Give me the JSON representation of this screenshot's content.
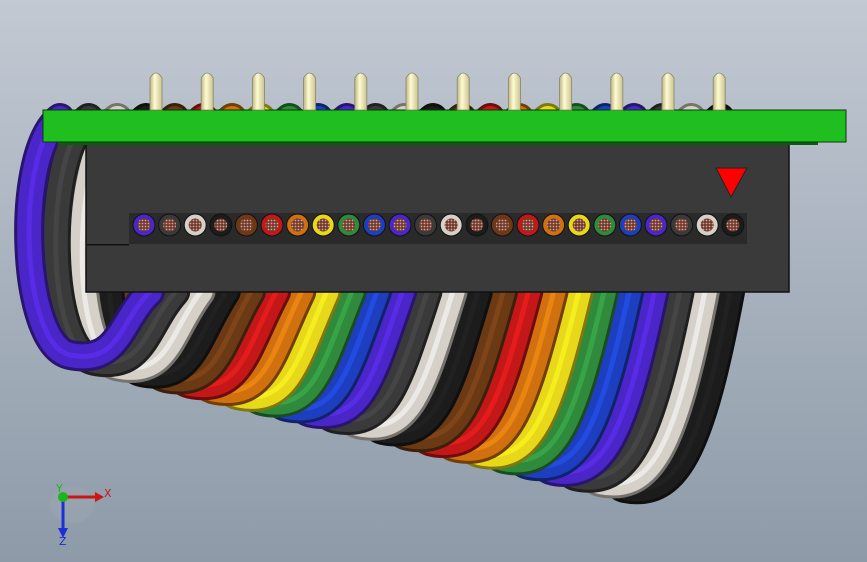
{
  "viewport": {
    "background_top": "#c2c9d3",
    "background_bottom": "#8d9aa8"
  },
  "model": {
    "pcb_color": "#1fbf1f",
    "pin_color": "#f3eeb6",
    "pin_count": 12,
    "connector_body_color": "#3a3a3a",
    "polarity_marker_color": "#ff0000",
    "wire_colors": [
      "#4a25c8",
      "#3a3a3a",
      "#d6d1c8",
      "#1c1c1c",
      "#6b3a15",
      "#c41818",
      "#d0700f",
      "#e8d81a",
      "#2f8a3c",
      "#1d3fbf",
      "#4a25c8",
      "#3a3a3a",
      "#d6d1c8",
      "#1c1c1c",
      "#6b3a15",
      "#c41818",
      "#d0700f",
      "#e8d81a",
      "#2f8a3c",
      "#1d3fbf",
      "#4a25c8",
      "#3a3a3a",
      "#d6d1c8",
      "#1c1c1c"
    ]
  },
  "triad": {
    "x_label": "X",
    "y_label": "Y",
    "z_label": "Z",
    "x_color": "#cc1515",
    "y_color": "#18b818",
    "z_color": "#1b2fd6"
  }
}
